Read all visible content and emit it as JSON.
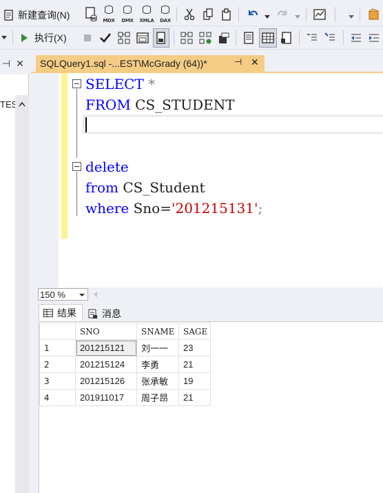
{
  "toolbar1": {
    "new_query_label": "新建查询(N)",
    "mdx": "MDX",
    "dmx": "DMX",
    "xmla": "XMLA",
    "dax": "DAX"
  },
  "toolbar2": {
    "execute_label": "执行(X)"
  },
  "left_panel": {
    "header_label": "TES"
  },
  "document_tab": {
    "title": "SQLQuery1.sql -...EST\\McGrady (64))*",
    "pin_glyph": "⊣",
    "close_glyph": "✕"
  },
  "editor": {
    "lines": [
      {
        "kw": "SELECT",
        "rest": " *"
      },
      {
        "kw": "FROM",
        "rest": " CS_STUDENT"
      },
      {
        "kw": "delete",
        "rest": ""
      },
      {
        "kw": "from",
        "rest": " CS_Student"
      },
      {
        "kw": "where",
        "rest": " Sno=",
        "str": "'201215131'",
        "tail": ";"
      }
    ]
  },
  "zoom": {
    "value": "150 %"
  },
  "results": {
    "tab_results": "结果",
    "tab_messages": "消息",
    "columns": [
      "SNO",
      "SNAME",
      "SAGE"
    ],
    "rows": [
      {
        "n": "1",
        "sno": "201215121",
        "sname": "刘一一",
        "sage": "23"
      },
      {
        "n": "2",
        "sno": "201215124",
        "sname": "李勇",
        "sage": "21"
      },
      {
        "n": "3",
        "sno": "201215126",
        "sname": "张承敏",
        "sage": "19"
      },
      {
        "n": "4",
        "sno": "201911017",
        "sname": "周子昂",
        "sage": "21"
      }
    ]
  }
}
